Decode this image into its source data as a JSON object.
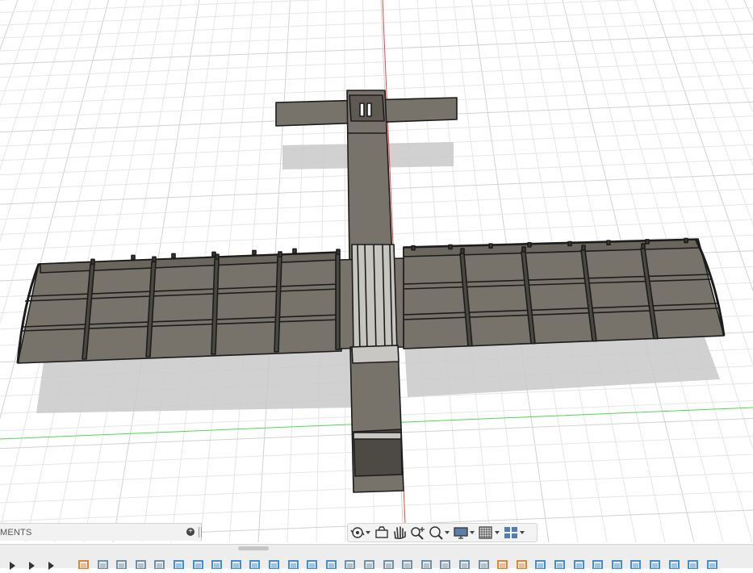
{
  "canvas": {
    "colors": {
      "background": "#ffffff",
      "grid_minor": "#e6e6e6",
      "grid_major": "#d2d2d2",
      "axis_red": "#e64a4a",
      "axis_green": "#54d654",
      "part_fill": "#77736a",
      "part_edge": "#1c1c1c",
      "shadow": "#c9c9c9"
    }
  },
  "browser": {
    "comments_label": "MENTS",
    "add_icon": "plus-circle-icon"
  },
  "nav_toolbar": {
    "items": [
      "orbit-icon",
      "look-at-icon",
      "pan-icon",
      "zoom-icon",
      "fit-icon",
      "display-settings-icon",
      "grid-settings-icon",
      "viewports-icon"
    ]
  },
  "timeline": {
    "controls": [
      "play-back-icon",
      "play-icon",
      "skip-end-icon"
    ],
    "feature_icon_colors": {
      "sketch": "#e0862a",
      "extrude": "#3c8fd6",
      "plane": "#6f8fa8"
    }
  }
}
